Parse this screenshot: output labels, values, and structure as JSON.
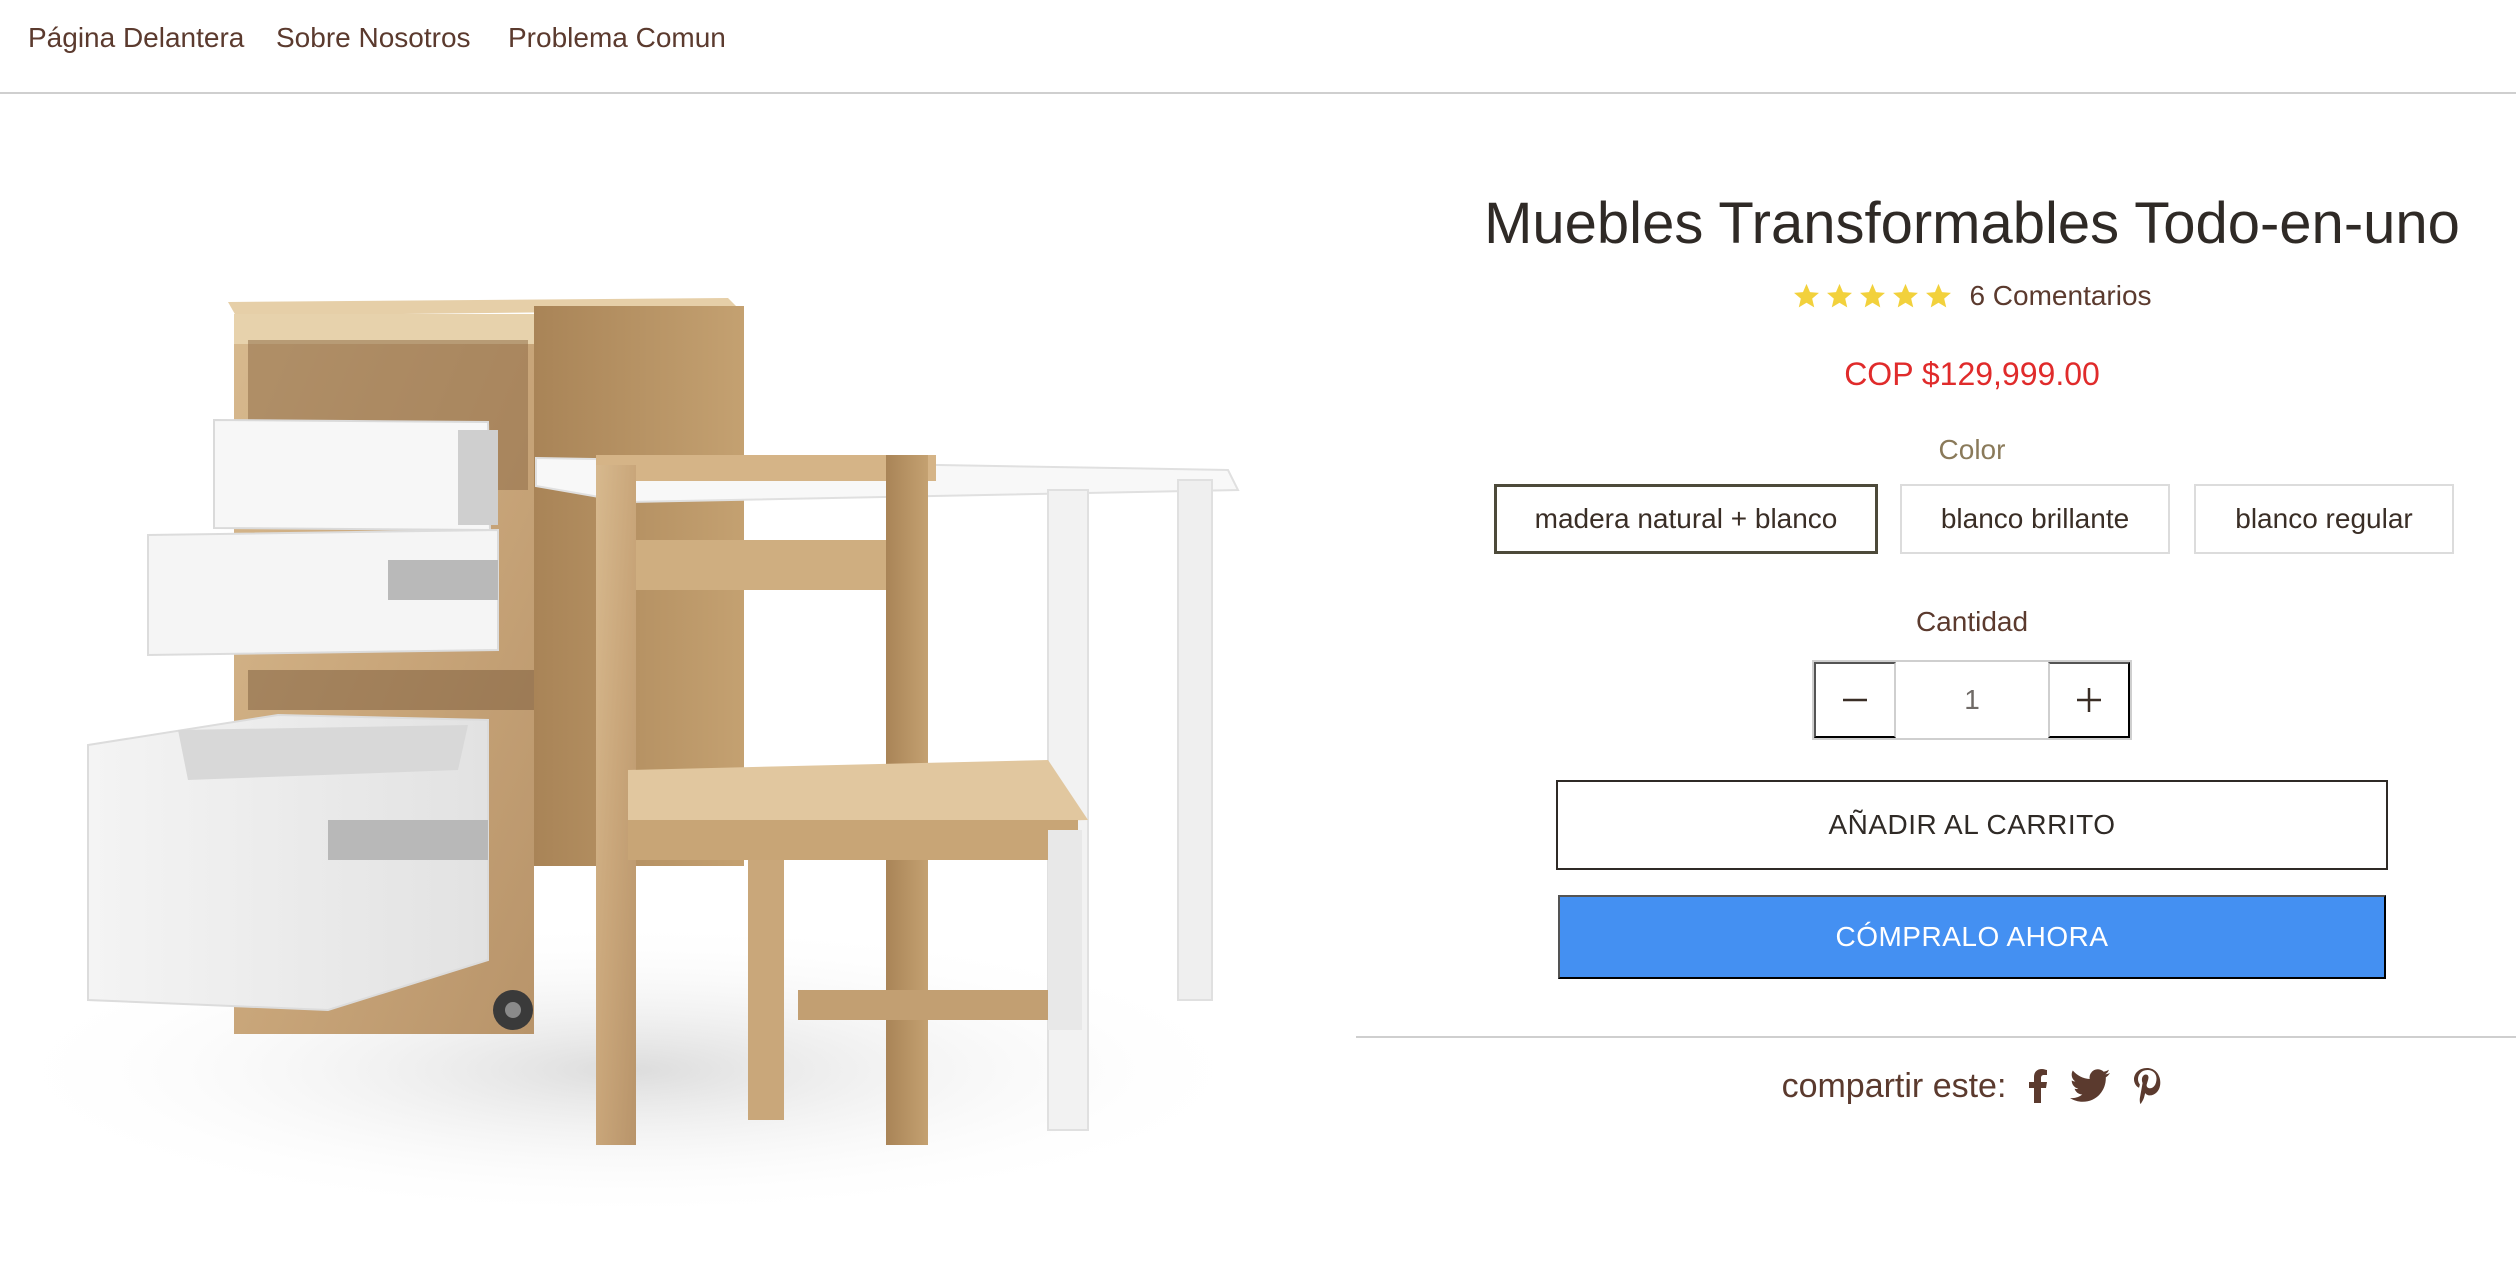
{
  "nav": {
    "items": [
      "Página Delantera",
      "Sobre Nosotros",
      "Problema Comun"
    ]
  },
  "product": {
    "title": "Muebles Transformables Todo-en-uno",
    "rating": 5,
    "reviews_label": "6 Comentarios",
    "price": "COP $129,999.00",
    "color_label": "Color",
    "colors": [
      "madera natural + blanco",
      "blanco brillante",
      "blanco regular"
    ],
    "selected_color": "madera natural + blanco",
    "quantity_label": "Cantidad",
    "quantity": "1",
    "add_to_cart": "AÑADIR AL CARRITO",
    "buy_now": "CÓMPRALO AHORA",
    "share_label": "compartir este:",
    "share_icons": [
      "facebook-icon",
      "twitter-icon",
      "pinterest-icon"
    ]
  },
  "colors": {
    "brown_text": "#5b3a2e",
    "price_red": "#e02b2b",
    "star_yellow": "#f2d13c",
    "buy_blue": "#4490f2",
    "swatch_selected_border": "#4d4a3a"
  }
}
